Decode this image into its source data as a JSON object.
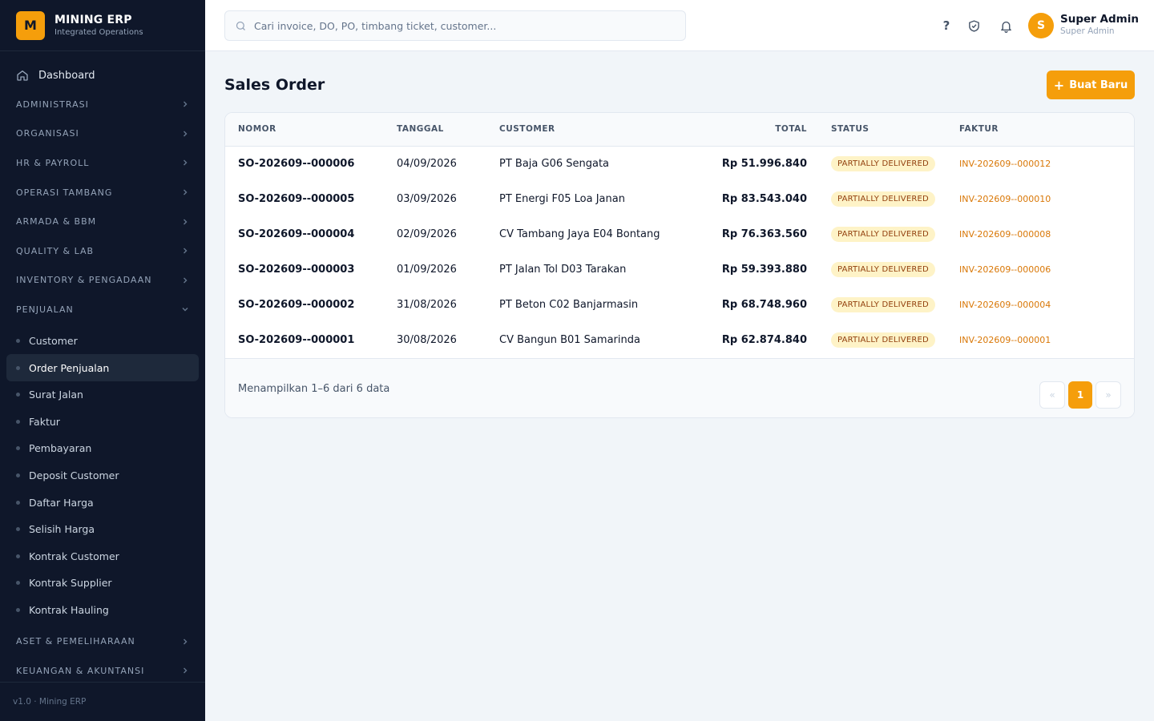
{
  "brand": {
    "logo_letter": "M",
    "title": "MINING ERP",
    "subtitle": "Integrated Operations"
  },
  "sidebar": {
    "dashboard": "Dashboard",
    "groups_top": [
      "ADMINISTRASI",
      "ORGANISASI",
      "HR & PAYROLL",
      "OPERASI TAMBANG",
      "ARMADA & BBM",
      "QUALITY & LAB",
      "INVENTORY & PENGADAAN"
    ],
    "open_group": "PENJUALAN",
    "open_group_items": [
      "Customer",
      "Order Penjualan",
      "Surat Jalan",
      "Faktur",
      "Pembayaran",
      "Deposit Customer",
      "Daftar Harga",
      "Selisih Harga",
      "Kontrak Customer",
      "Kontrak Supplier",
      "Kontrak Hauling"
    ],
    "active_item": "Order Penjualan",
    "groups_bottom": [
      "ASET & PEMELIHARAAN",
      "KEUANGAN & AKUNTANSI"
    ],
    "footer": "v1.0 · Mining ERP"
  },
  "header": {
    "search_placeholder": "Cari invoice, DO, PO, timbang ticket, customer...",
    "help_glyph": "?",
    "user_initial": "S",
    "user_name": "Super Admin",
    "user_role": "Super Admin"
  },
  "page": {
    "title": "Sales Order",
    "new_button": "Buat Baru",
    "new_icon": "+"
  },
  "table": {
    "columns": [
      "NOMOR",
      "TANGGAL",
      "CUSTOMER",
      "TOTAL",
      "STATUS",
      "FAKTUR"
    ],
    "rows": [
      [
        "SO-202609--000006",
        "04/09/2026",
        "PT Baja G06 Sengata",
        "Rp 51.996.840",
        "PARTIALLY DELIVERED",
        "INV-202609--000012"
      ],
      [
        "SO-202609--000005",
        "03/09/2026",
        "PT Energi F05 Loa Janan",
        "Rp 83.543.040",
        "PARTIALLY DELIVERED",
        "INV-202609--000010"
      ],
      [
        "SO-202609--000004",
        "02/09/2026",
        "CV Tambang Jaya E04 Bontang",
        "Rp 76.363.560",
        "PARTIALLY DELIVERED",
        "INV-202609--000008"
      ],
      [
        "SO-202609--000003",
        "01/09/2026",
        "PT Jalan Tol D03 Tarakan",
        "Rp 59.393.880",
        "PARTIALLY DELIVERED",
        "INV-202609--000006"
      ],
      [
        "SO-202609--000002",
        "31/08/2026",
        "PT Beton C02 Banjarmasin",
        "Rp 68.748.960",
        "PARTIALLY DELIVERED",
        "INV-202609--000004"
      ],
      [
        "SO-202609--000001",
        "30/08/2026",
        "CV Bangun B01 Samarinda",
        "Rp 62.874.840",
        "PARTIALLY DELIVERED",
        "INV-202609--000001"
      ]
    ],
    "footer_info": "Menampilkan 1–6 dari 6 data",
    "pager": {
      "prev": "«",
      "current": "1",
      "next": "»"
    }
  },
  "colors": {
    "accent": "#f59e0b",
    "sidebar_bg": "#0f172a",
    "badge_bg": "#fef3c7",
    "badge_text": "#92400e",
    "link": "#d97706"
  }
}
